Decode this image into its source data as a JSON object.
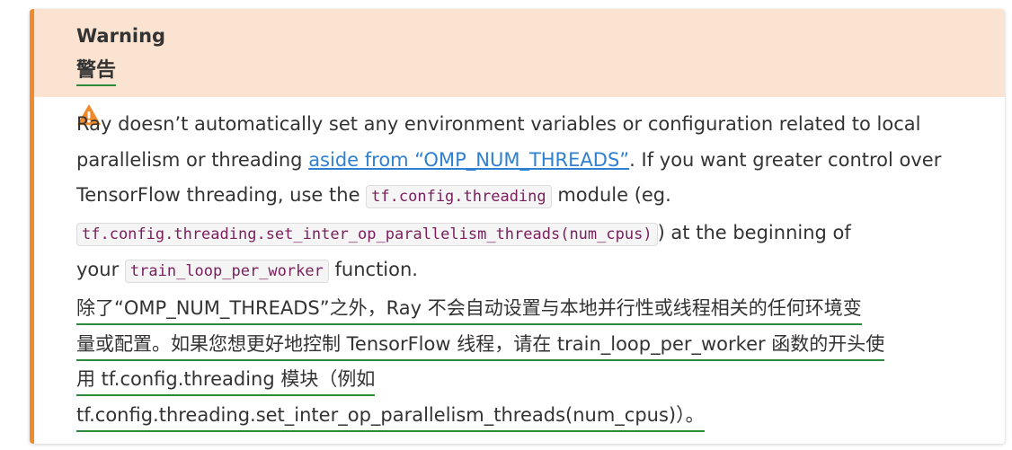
{
  "admonition": {
    "title": "Warning",
    "title_zh": "警告",
    "icon": "warning-triangle-icon",
    "accent_color": "#f08a2c",
    "header_bg": "#fbe3d1",
    "body": {
      "line1": "Ray doesn’t automatically set any environment variables or configuration related to local",
      "line2_before": "parallelism or threading ",
      "line2_link": "aside from “OMP_NUM_THREADS”",
      "line2_after": ". If you want greater control over",
      "line3_before": "TensorFlow threading, use the ",
      "line3_code": "tf.config.threading",
      "line3_after": " module (eg.",
      "line4_code": "tf.config.threading.set_inter_op_parallelism_threads(num_cpus)",
      "line4_after": ") at the beginning of",
      "line5_before": "your ",
      "line5_code": "train_loop_per_worker",
      "line5_after": " function."
    },
    "translation": {
      "line1": "除了“OMP_NUM_THREADS”之外，Ray 不会自动设置与本地并行性或线程相关的任何环境变",
      "line2": "量或配置。如果您想更好地控制 TensorFlow 线程，请在 train_loop_per_worker 函数的开头使",
      "line3": "用 tf.config.threading 模块（例如",
      "line4": "tf.config.threading.set_inter_op_parallelism_threads(num_cpus)）。"
    }
  }
}
